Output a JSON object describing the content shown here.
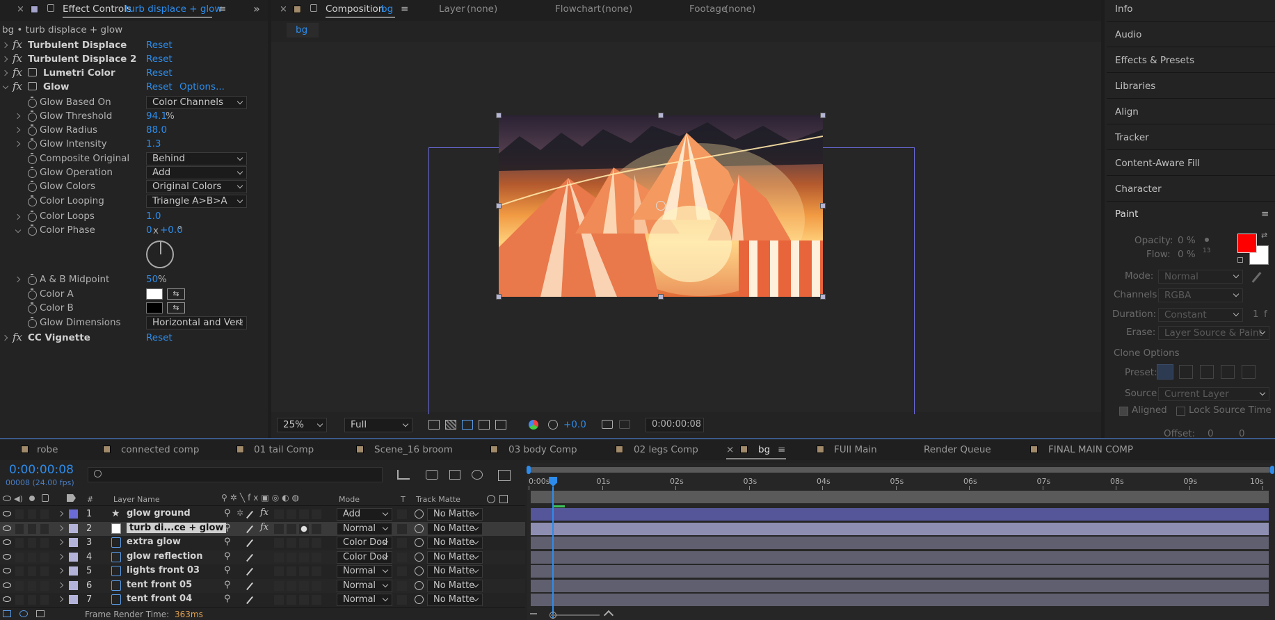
{
  "effect_controls": {
    "tab_title": "Effect Controls",
    "tab_layer": "turb displace + glow",
    "breadcrumb": "bg • turb displace + glow",
    "effects": [
      {
        "name": "Turbulent Displace",
        "reset": "Reset"
      },
      {
        "name": "Turbulent Displace 2",
        "reset": "Reset"
      },
      {
        "name": "Lumetri Color",
        "reset": "Reset"
      },
      {
        "name": "Glow",
        "reset": "Reset",
        "options": "Options..."
      },
      {
        "name": "CC Vignette",
        "reset": "Reset"
      }
    ],
    "glow_props": {
      "based_on": {
        "label": "Glow Based On",
        "value": "Color Channels"
      },
      "threshold": {
        "label": "Glow Threshold",
        "value": "94.1",
        "unit": "%"
      },
      "radius": {
        "label": "Glow Radius",
        "value": "88.0"
      },
      "intensity": {
        "label": "Glow Intensity",
        "value": "1.3"
      },
      "composite": {
        "label": "Composite Original",
        "value": "Behind"
      },
      "operation": {
        "label": "Glow Operation",
        "value": "Add"
      },
      "colors": {
        "label": "Glow Colors",
        "value": "Original Colors"
      },
      "looping": {
        "label": "Color Looping",
        "value": "Triangle A>B>A"
      },
      "loops": {
        "label": "Color Loops",
        "value": "1.0"
      },
      "phase": {
        "label": "Color Phase",
        "value": "0",
        "mid": "x",
        "value2": "+0.0",
        "unit": "°"
      },
      "midpoint": {
        "label": "A & B Midpoint",
        "value": "50",
        "unit": "%"
      },
      "color_a": {
        "label": "Color A",
        "swatch": "#ffffff"
      },
      "color_b": {
        "label": "Color B",
        "swatch": "#000000"
      },
      "dimensions": {
        "label": "Glow Dimensions",
        "value": "Horizontal and Vert"
      }
    }
  },
  "composition": {
    "tab_title": "Composition",
    "tab_comp": "bg",
    "layer_tab": "Layer",
    "layer_value": "(none)",
    "flowchart_tab": "Flowchart",
    "flowchart_value": "(none)",
    "footage_tab": "Footage",
    "footage_value": "(none)",
    "comp_chip": "bg",
    "zoom": "25%",
    "resolution": "Full",
    "exposure": "+0.0",
    "timecode": "0:00:00:08"
  },
  "right_panels": [
    "Info",
    "Audio",
    "Effects & Presets",
    "Libraries",
    "Align",
    "Tracker",
    "Content-Aware Fill",
    "Character"
  ],
  "paint": {
    "title": "Paint",
    "opacity_label": "Opacity:",
    "opacity_value": "0 %",
    "flow_label": "Flow:",
    "flow_value": "0 %",
    "brush_size": "13",
    "mode_label": "Mode:",
    "mode_value": "Normal",
    "channels_label": "Channels:",
    "channels_value": "RGBA",
    "duration_label": "Duration:",
    "duration_value": "Constant",
    "duration_extra": "1",
    "duration_unit": "f",
    "erase_label": "Erase:",
    "erase_value": "Layer Source & Paint",
    "clone_label": "Clone Options",
    "preset_label": "Preset:",
    "source_label": "Source:",
    "source_value": "Current Layer",
    "aligned_label": "Aligned",
    "lock_label": "Lock Source Time",
    "offset_label": "Offset:",
    "offset_x": "0",
    "offset_y": "0",
    "fg_color": "#ff0000",
    "bg_color": "#ffffff"
  },
  "timeline_tabs": [
    {
      "label": "robe",
      "color": "#a08a6a"
    },
    {
      "label": "connected comp",
      "color": "#a08a6a"
    },
    {
      "label": "01 tail Comp",
      "color": "#a08a6a"
    },
    {
      "label": "Scene_16 broom",
      "color": "#a08a6a"
    },
    {
      "label": "03 body Comp",
      "color": "#a08a6a"
    },
    {
      "label": "02 legs Comp",
      "color": "#a08a6a"
    },
    {
      "label": "bg",
      "color": ""
    },
    {
      "label": "FUll Main",
      "color": ""
    },
    {
      "label": "Render Queue",
      "color": ""
    },
    {
      "label": "FINAL MAIN COMP",
      "color": "#a08a6a"
    }
  ],
  "timeline": {
    "timecode": "0:00:00:08",
    "frames": "00008 (24.00 fps)",
    "search_placeholder": "",
    "col_layer_name": "Layer Name",
    "col_mode": "Mode",
    "col_t": "T",
    "col_track_matte": "Track Matte",
    "col_num": "#",
    "ruler": [
      "0:00s",
      "01s",
      "02s",
      "03s",
      "04s",
      "05s",
      "06s",
      "07s",
      "08s",
      "09s",
      "10s"
    ],
    "playhead_frame": 8,
    "layers": [
      {
        "num": "1",
        "name": "glow ground",
        "mode": "Add",
        "matte": "No Matte",
        "label": "#6b6bd6",
        "type": "star",
        "fx": true
      },
      {
        "num": "2",
        "name": "turb di...ce + glow",
        "mode": "Normal",
        "matte": "No Matte",
        "label": "#b3b3d9",
        "type": "solid",
        "fx": true
      },
      {
        "num": "3",
        "name": "extra glow",
        "mode": "Color Dod",
        "matte": "No Matte",
        "label": "#b3b3d9",
        "type": "file",
        "fx": false
      },
      {
        "num": "4",
        "name": "glow reflection",
        "mode": "Color Dod",
        "matte": "No Matte",
        "label": "#b3b3d9",
        "type": "file",
        "fx": false
      },
      {
        "num": "5",
        "name": "lights front 03",
        "mode": "Normal",
        "matte": "No Matte",
        "label": "#b3b3d9",
        "type": "file",
        "fx": false
      },
      {
        "num": "6",
        "name": "tent front 05",
        "mode": "Normal",
        "matte": "No Matte",
        "label": "#b3b3d9",
        "type": "file",
        "fx": false
      },
      {
        "num": "7",
        "name": "tent front 04",
        "mode": "Normal",
        "matte": "No Matte",
        "label": "#b3b3d9",
        "type": "file",
        "fx": false
      }
    ],
    "render_time_label": "Frame Render Time:",
    "render_time_value": "363ms"
  }
}
